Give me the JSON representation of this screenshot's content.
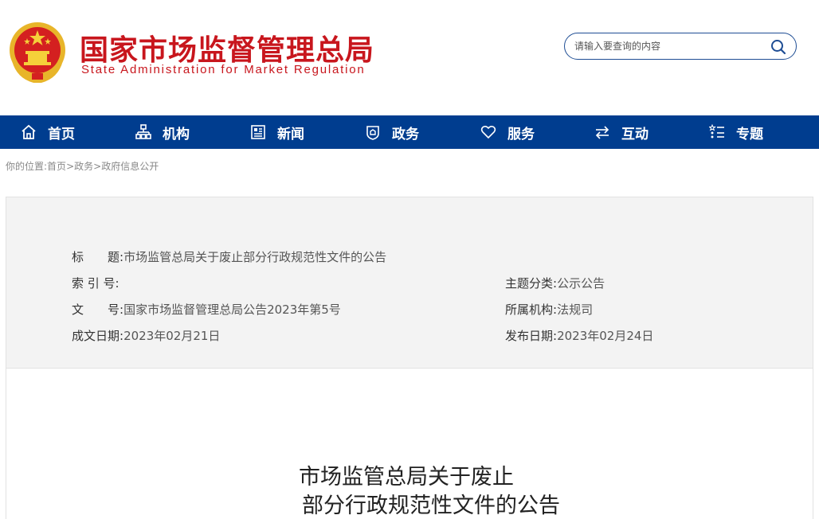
{
  "header": {
    "title_cn": "国家市场监督管理总局",
    "title_en": "State Administration for Market Regulation",
    "search_placeholder": "请输入要查询的内容"
  },
  "nav": {
    "items": [
      {
        "label": "首页",
        "icon": "home-icon"
      },
      {
        "label": "机构",
        "icon": "org-chart-icon"
      },
      {
        "label": "新闻",
        "icon": "news-icon"
      },
      {
        "label": "政务",
        "icon": "government-affairs-icon"
      },
      {
        "label": "服务",
        "icon": "heart-icon"
      },
      {
        "label": "互动",
        "icon": "exchange-arrows-icon"
      },
      {
        "label": "专题",
        "icon": "topic-list-icon"
      }
    ]
  },
  "breadcrumb": {
    "prefix": "你的位置:",
    "items": [
      "首页",
      "政务",
      "政府信息公开"
    ],
    "separator": ">"
  },
  "info": {
    "title_label": "标　　题:",
    "title_value": "市场监管总局关于废止部分行政规范性文件的公告",
    "index_label": "索 引 号:",
    "index_value": "",
    "topic_label": "主题分类:",
    "topic_value": "公示公告",
    "docno_label": "文　　号:",
    "docno_value": "国家市场监督管理总局公告2023年第5号",
    "agency_label": "所属机构:",
    "agency_value": "法规司",
    "created_label": "成文日期:",
    "created_value": "2023年02月21日",
    "published_label": "发布日期:",
    "published_value": "2023年02月24日"
  },
  "document": {
    "title_line1": "市场监管总局关于废止",
    "title_line2": "部分行政规范性文件的公告"
  },
  "colors": {
    "brand_red": "#c8161d",
    "nav_blue": "#003d8f",
    "emblem_gold": "#f2c230"
  }
}
